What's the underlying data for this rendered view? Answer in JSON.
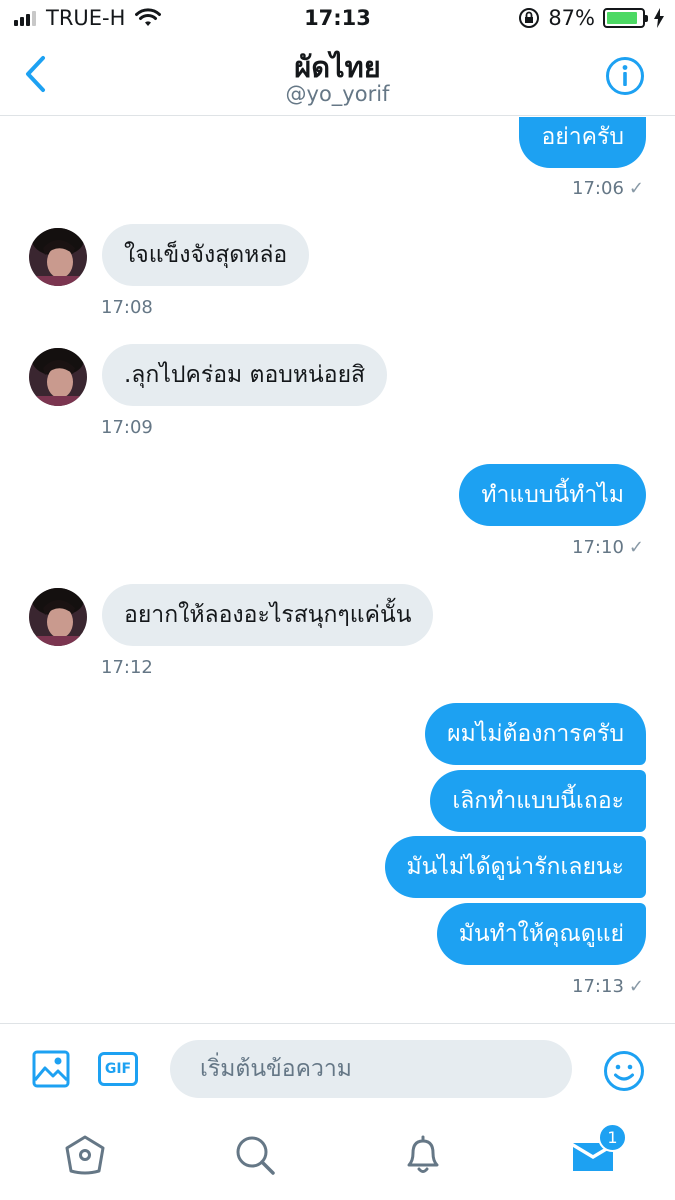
{
  "status_bar": {
    "carrier": "TRUE-H",
    "time": "17:13",
    "battery": "87%",
    "battery_level": 0.87
  },
  "header": {
    "title": "ผัดไทย",
    "handle": "@yo_yorif"
  },
  "messages": {
    "m1": {
      "text": "อย่าครับ",
      "time": "17:06"
    },
    "m2": {
      "text": "ใจแข็งจังสุดหล่อ",
      "time": "17:08"
    },
    "m3": {
      "text": ".ลุกไปคร่อม ตอบหน่อยสิ",
      "time": "17:09"
    },
    "m4": {
      "text": "ทำแบบนี้ทำไม",
      "time": "17:10"
    },
    "m5": {
      "text": "อยากให้ลองอะไรสนุกๆแค่นั้น",
      "time": "17:12"
    },
    "m6": {
      "text": "ผมไม่ต้องการครับ"
    },
    "m7": {
      "text": "เลิกทำแบบนี้เถอะ"
    },
    "m8": {
      "text": "มันไม่ได้ดูน่ารักเลยนะ"
    },
    "m9": {
      "text": "มันทำให้คุณดูแย่",
      "time": "17:13"
    },
    "check_mark": "✓"
  },
  "composer": {
    "gif_label": "GIF",
    "placeholder": "เริ่มต้นข้อความ"
  },
  "tabbar": {
    "messages_badge": "1"
  },
  "colors": {
    "accent": "#1da1f2",
    "received_bubble": "#e6ecf0",
    "secondary_text": "#657786"
  }
}
